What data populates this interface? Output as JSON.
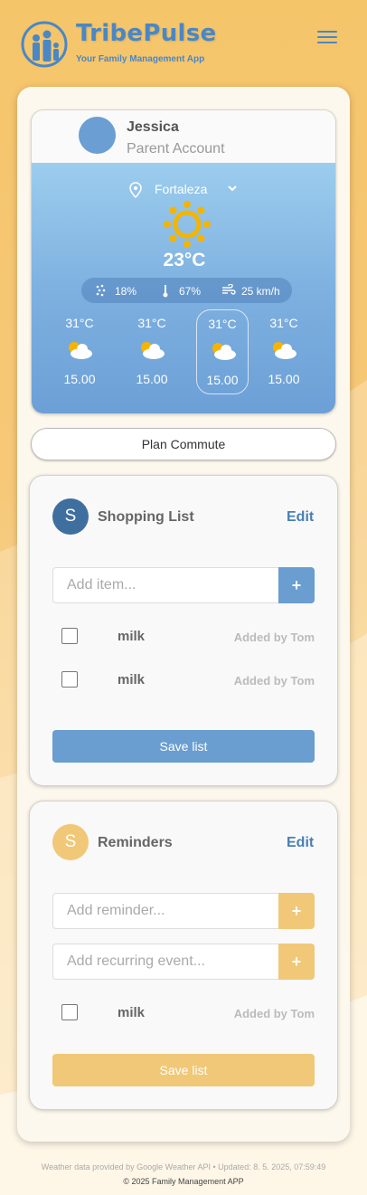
{
  "app": {
    "title": "TribePulse",
    "subtitle": "Your Family Management App"
  },
  "profile": {
    "name": "Jessica",
    "role": "Parent Account"
  },
  "weather": {
    "location": "Fortaleza",
    "temperature": "23°C",
    "precipitation": "18%",
    "humidity": "67%",
    "wind": "25 km/h",
    "forecast": [
      {
        "temp": "31°C",
        "time": "15.00",
        "icon": "partly-cloudy-icon",
        "selected": false
      },
      {
        "temp": "31°C",
        "time": "15.00",
        "icon": "partly-cloudy-icon",
        "selected": false
      },
      {
        "temp": "31°C",
        "time": "15.00",
        "icon": "partly-cloudy-icon",
        "selected": true
      },
      {
        "temp": "31°C",
        "time": "15.00",
        "icon": "partly-cloudy-icon",
        "selected": false
      }
    ]
  },
  "commute": {
    "label": "Plan Commute"
  },
  "shopping": {
    "badge": "S",
    "title": "Shopping List",
    "edit_label": "Edit",
    "add_placeholder": "Add item...",
    "add_symbol": "+",
    "items": [
      {
        "name": "milk",
        "added_by": "Added by Tom"
      },
      {
        "name": "milk",
        "added_by": "Added by Tom"
      }
    ],
    "save_label": "Save list",
    "color": "#6a9dd0"
  },
  "reminders": {
    "badge": "S",
    "title": "Reminders",
    "edit_label": "Edit",
    "add_placeholder": "Add reminder...",
    "recurring_placeholder": "Add recurring event...",
    "add_symbol": "+",
    "items": [
      {
        "name": "milk",
        "added_by": "Added by Tom"
      }
    ],
    "save_label": "Save list",
    "color": "#f0c878"
  },
  "footer": {
    "attribution": "Weather data provided by Google Weather API • Updated: 8. 5. 2025, 07:59:49",
    "copyright": "© 2025 Family Management APP"
  },
  "colors": {
    "brand_blue": "#4a87c4",
    "accent_yellow": "#f0c878",
    "background": "#f6c878"
  }
}
